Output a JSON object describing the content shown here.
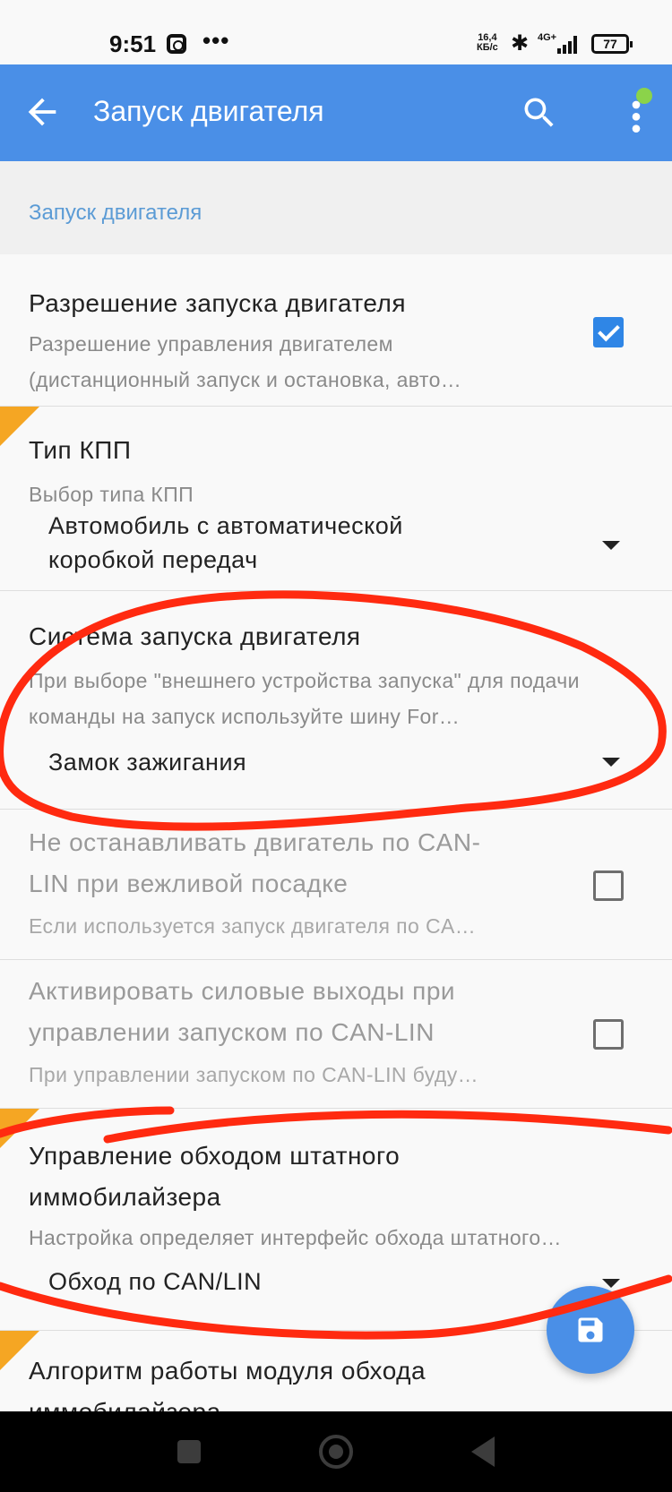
{
  "status_bar": {
    "time": "9:51",
    "dots": "•••",
    "speed_value": "16,4",
    "speed_unit": "КБ/с",
    "network": "4G+",
    "battery": "77"
  },
  "app_bar": {
    "title": "Запуск двигателя",
    "back_icon": "arrow-left",
    "search_icon": "search",
    "menu_icon": "more-vertical"
  },
  "section_header": "Запуск двигателя",
  "preferences": [
    {
      "title": "Разрешение запуска двигателя",
      "summary": "Разрешение управления двигателем (дистанционный запуск и остановка, авто…",
      "checked": true
    },
    {
      "title": "Тип КПП",
      "summary": "Выбор типа КПП",
      "value_line1": "Автомобиль с автоматической",
      "value_line2": "коробкой передач"
    },
    {
      "title": "Система запуска двигателя",
      "summary": "При выборе \"внешнего устройства запуска\" для подачи команды на запуск используйте шину For…",
      "value": "Замок зажигания"
    },
    {
      "title_line1": "Не останавливать двигатель по CAN-",
      "title_line2": "LIN при вежливой посадке",
      "summary": "Если используется запуск двигателя по CA…",
      "checked": false
    },
    {
      "title_line1": "Активировать силовые выходы при",
      "title_line2": "управлении запуском по CAN-LIN",
      "summary": "При управлении запуском по CAN-LIN буду…",
      "checked": false
    },
    {
      "title_line1": "Управление обходом штатного",
      "title_line2": "иммобилайзера",
      "summary": "Настройка определяет интерфейс обхода штатного…",
      "value": "Обход по CAN/LIN"
    },
    {
      "title_line1": "Алгоритм работы модуля обхода",
      "title_line2": "иммобилайзера"
    }
  ],
  "fab_icon": "save",
  "colors": {
    "primary": "#4a8fe7",
    "accent_checkbox": "#2f86e6",
    "section_header_text": "#5b9bd5",
    "annotation": "#ff2a10",
    "corner_marker": "#f5a623"
  }
}
